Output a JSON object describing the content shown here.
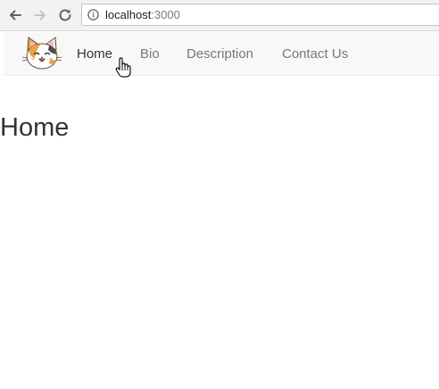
{
  "browser": {
    "url_host": "localhost",
    "url_port": ":3000",
    "back_icon": "arrow-left",
    "forward_icon": "arrow-right",
    "reload_icon": "reload",
    "info_icon": "info-circle"
  },
  "navbar": {
    "logo_icon": "calico-cat-face",
    "links": [
      {
        "label": "Home",
        "active": true
      },
      {
        "label": "Bio",
        "active": false
      },
      {
        "label": "Description",
        "active": false
      },
      {
        "label": "Contact Us",
        "active": false
      }
    ]
  },
  "main": {
    "heading": "Home"
  },
  "colors": {
    "nav_background": "#f8f8f8",
    "link_active": "#333333",
    "link_inactive": "#777777"
  }
}
